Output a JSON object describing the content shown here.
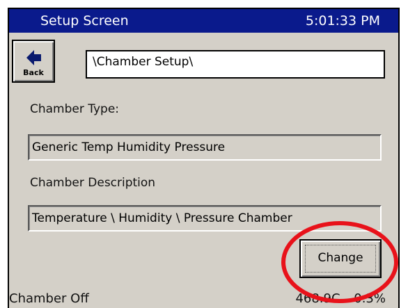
{
  "titlebar": {
    "title": "Setup Screen",
    "time": "5:01:33 PM"
  },
  "back_button": {
    "label": "Back",
    "icon": "left-arrow-icon"
  },
  "path": {
    "value": "\\Chamber Setup\\"
  },
  "chamber_type": {
    "label": "Chamber Type:",
    "value": "Generic Temp Humidity Pressure"
  },
  "chamber_description": {
    "label": "Chamber Description",
    "value": "Temperature \\ Humidity \\ Pressure Chamber"
  },
  "change_button": {
    "label": "Change"
  },
  "status": {
    "state": "Chamber Off",
    "readout": "468.9C 0.3%"
  },
  "colors": {
    "titlebar": "#0a1a8c",
    "panel": "#d4d0c8",
    "highlight_ring": "#e8121a"
  }
}
